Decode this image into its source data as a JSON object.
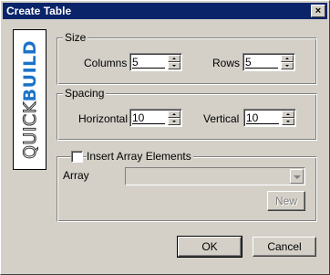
{
  "window": {
    "title": "Create Table",
    "close_glyph": "×"
  },
  "logo": {
    "part1": "QUICK",
    "part2": "BUILD",
    "accent": "#1a73c8"
  },
  "size": {
    "title": "Size",
    "columns_label": "Columns",
    "columns_value": "5",
    "rows_label": "Rows",
    "rows_value": "5"
  },
  "spacing": {
    "title": "Spacing",
    "horizontal_label": "Horizontal",
    "horizontal_value": "10",
    "vertical_label": "Vertical",
    "vertical_value": "10"
  },
  "array": {
    "checkbox_label": "Insert Array Elements",
    "checked": false,
    "array_label": "Array",
    "array_value": "",
    "new_label": "New"
  },
  "buttons": {
    "ok_label": "OK",
    "cancel_label": "Cancel"
  },
  "colors": {
    "face": "#d4d0c8",
    "titlebar": "#0a246a"
  }
}
